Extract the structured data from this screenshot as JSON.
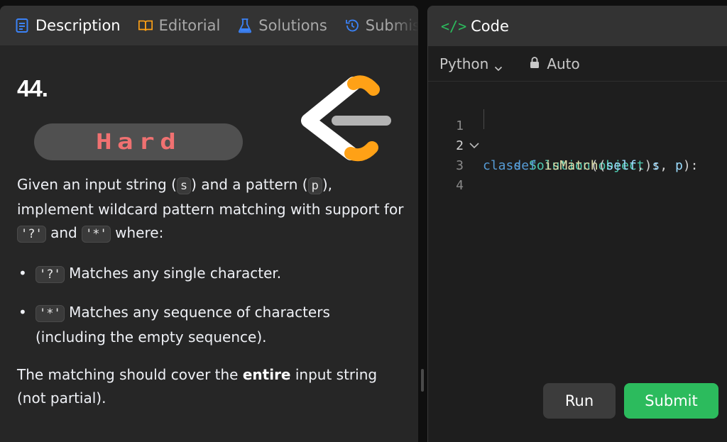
{
  "tabs": [
    {
      "label": "Description",
      "icon": "description-icon"
    },
    {
      "label": "Editorial",
      "icon": "book-icon"
    },
    {
      "label": "Solutions",
      "icon": "flask-icon"
    },
    {
      "label": "Submis",
      "icon": "history-icon"
    }
  ],
  "problem": {
    "number": "44.",
    "difficulty": "Hard",
    "desc_p1": [
      "Given an input string (",
      "s",
      ") and a pattern (",
      "p",
      "), implement wildcard pattern matching with support for ",
      "'?'",
      " and ",
      "'*'",
      " where:"
    ],
    "bullets": [
      {
        "code": "'?'",
        "text": " Matches any single character."
      },
      {
        "code": "'*'",
        "text": " Matches any sequence of characters (including the empty sequence)."
      }
    ],
    "desc_p2_pre": "The matching should cover the ",
    "desc_p2_bold": "entire",
    "desc_p2_post": " input string (not partial)."
  },
  "code_panel": {
    "title": "Code",
    "language": "Python",
    "mode": "Auto",
    "lines": [
      {
        "num": "1",
        "text": "class Solution(object):"
      },
      {
        "num": "2",
        "text": "    def isMatch(self, s, p):"
      },
      {
        "num": "3",
        "text": ""
      },
      {
        "num": "4",
        "text": ""
      }
    ],
    "run_label": "Run",
    "submit_label": "Submit"
  },
  "colors": {
    "accent": "#2cbb5d",
    "hard": "#f07171",
    "logo_orange": "#ffa116"
  }
}
